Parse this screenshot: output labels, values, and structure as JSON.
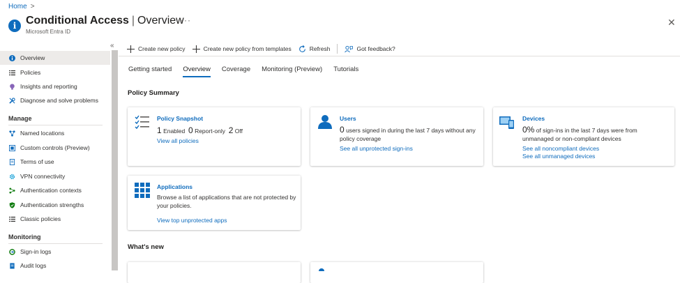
{
  "breadcrumb": {
    "home": "Home",
    "separator": ">"
  },
  "header": {
    "icon": "info-icon",
    "title_main": "Conditional Access",
    "title_sep": "|",
    "title_sub": "Overview",
    "subtitle": "Microsoft Entra ID",
    "more": "···",
    "close": "✕"
  },
  "sidebar": {
    "collapse": "«",
    "items": [
      {
        "label": "Overview",
        "icon": "info-icon",
        "active": true
      },
      {
        "label": "Policies",
        "icon": "list-icon"
      },
      {
        "label": "Insights and reporting",
        "icon": "lightbulb-icon"
      },
      {
        "label": "Diagnose and solve problems",
        "icon": "wrench-icon"
      }
    ],
    "manage_heading": "Manage",
    "manage_items": [
      {
        "label": "Named locations",
        "icon": "network-icon"
      },
      {
        "label": "Custom controls (Preview)",
        "icon": "controls-icon"
      },
      {
        "label": "Terms of use",
        "icon": "document-icon"
      },
      {
        "label": "VPN connectivity",
        "icon": "gear-icon"
      },
      {
        "label": "Authentication contexts",
        "icon": "context-icon"
      },
      {
        "label": "Authentication strengths",
        "icon": "shield-icon"
      },
      {
        "label": "Classic policies",
        "icon": "list-icon"
      }
    ],
    "monitoring_heading": "Monitoring",
    "monitoring_items": [
      {
        "label": "Sign-in logs",
        "icon": "signin-icon"
      },
      {
        "label": "Audit logs",
        "icon": "audit-icon"
      }
    ]
  },
  "toolbar": {
    "create_policy": "Create new policy",
    "create_from_templates": "Create new policy from templates",
    "refresh": "Refresh",
    "feedback": "Got feedback?"
  },
  "tabs": [
    "Getting started",
    "Overview",
    "Coverage",
    "Monitoring (Preview)",
    "Tutorials"
  ],
  "active_tab": "Overview",
  "policy_summary_title": "Policy Summary",
  "cards": {
    "snapshot": {
      "title": "Policy Snapshot",
      "enabled_count": "1",
      "enabled_label": "Enabled",
      "reportonly_count": "0",
      "reportonly_label": "Report-only",
      "off_count": "2",
      "off_label": "Off",
      "link": "View all policies"
    },
    "users": {
      "title": "Users",
      "count": "0",
      "text": "users signed in during the last 7 days without any policy coverage",
      "link": "See all unprotected sign-ins"
    },
    "devices": {
      "title": "Devices",
      "percent": "0%",
      "text": "of sign-ins in the last 7 days were from unmanaged or non-compliant devices",
      "link1": "See all noncompliant devices",
      "link2": "See all unmanaged devices"
    },
    "applications": {
      "title": "Applications",
      "text": "Browse a list of applications that are not protected by your policies.",
      "link": "View top unprotected apps"
    }
  },
  "whats_new_title": "What's new",
  "colors": {
    "accent": "#0f6cbd",
    "sidebar_active": "#edebe9"
  }
}
